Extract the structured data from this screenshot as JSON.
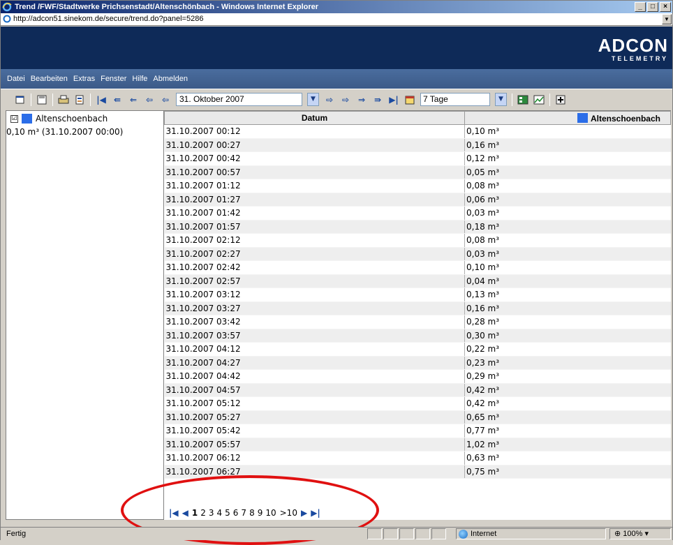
{
  "window": {
    "title": "Trend /FWF/Stadtwerke Prichsenstadt/Altenschönbach - Windows Internet Explorer",
    "address": "http://adcon51.sinekom.de/secure/trend.do?panel=5286"
  },
  "brand": {
    "name": "ADCON",
    "tagline": "TELEMETRY"
  },
  "menu": [
    "Datei",
    "Bearbeiten",
    "Extras",
    "Fenster",
    "Hilfe",
    "Abmelden"
  ],
  "toolbar": {
    "date": "31. Oktober 2007",
    "range": "7 Tage"
  },
  "legend": {
    "checkbox": "☑",
    "series_name": "Altenschoenbach",
    "current_value": "0,10 m³ (31.10.2007 00:00)",
    "color": "#2b6de8"
  },
  "table": {
    "headers": [
      "Datum",
      "Altenschoenbach"
    ],
    "rows": [
      [
        "31.10.2007 00:12",
        "0,10 m³"
      ],
      [
        "31.10.2007 00:27",
        "0,16 m³"
      ],
      [
        "31.10.2007 00:42",
        "0,12 m³"
      ],
      [
        "31.10.2007 00:57",
        "0,05 m³"
      ],
      [
        "31.10.2007 01:12",
        "0,08 m³"
      ],
      [
        "31.10.2007 01:27",
        "0,06 m³"
      ],
      [
        "31.10.2007 01:42",
        "0,03 m³"
      ],
      [
        "31.10.2007 01:57",
        "0,18 m³"
      ],
      [
        "31.10.2007 02:12",
        "0,08 m³"
      ],
      [
        "31.10.2007 02:27",
        "0,03 m³"
      ],
      [
        "31.10.2007 02:42",
        "0,10 m³"
      ],
      [
        "31.10.2007 02:57",
        "0,04 m³"
      ],
      [
        "31.10.2007 03:12",
        "0,13 m³"
      ],
      [
        "31.10.2007 03:27",
        "0,16 m³"
      ],
      [
        "31.10.2007 03:42",
        "0,28 m³"
      ],
      [
        "31.10.2007 03:57",
        "0,30 m³"
      ],
      [
        "31.10.2007 04:12",
        "0,22 m³"
      ],
      [
        "31.10.2007 04:27",
        "0,23 m³"
      ],
      [
        "31.10.2007 04:42",
        "0,29 m³"
      ],
      [
        "31.10.2007 04:57",
        "0,42 m³"
      ],
      [
        "31.10.2007 05:12",
        "0,42 m³"
      ],
      [
        "31.10.2007 05:27",
        "0,65 m³"
      ],
      [
        "31.10.2007 05:42",
        "0,77 m³"
      ],
      [
        "31.10.2007 05:57",
        "1,02 m³"
      ],
      [
        "31.10.2007 06:12",
        "0,63 m³"
      ],
      [
        "31.10.2007 06:27",
        "0,75 m³"
      ]
    ]
  },
  "pager": {
    "pages": [
      "1",
      "2",
      "3",
      "4",
      "5",
      "6",
      "7",
      "8",
      "9",
      "10"
    ],
    "current": "1",
    "next_ten": ">10"
  },
  "status": {
    "text": "Fertig",
    "zone": "Internet",
    "zoom": "100%"
  },
  "colors": {
    "banner": "#0e2a58",
    "menubar": "#4a6d9e",
    "highlight_ellipse": "#e01010"
  }
}
